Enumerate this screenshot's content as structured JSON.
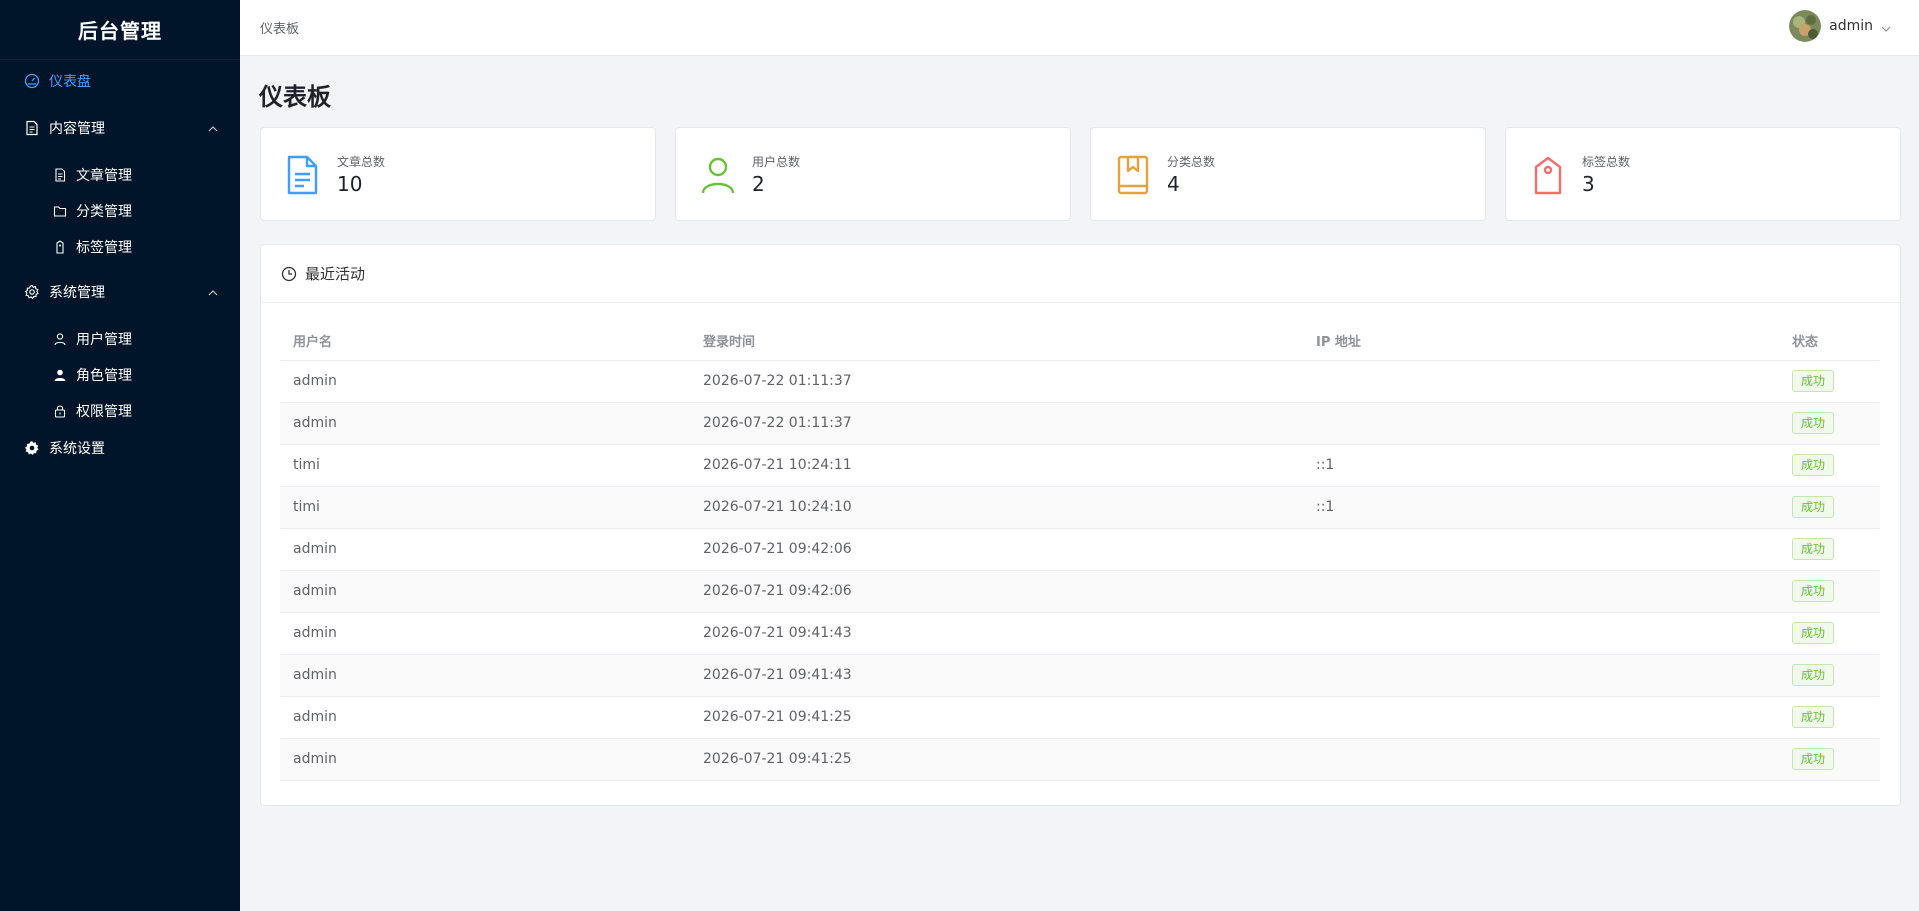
{
  "sidebar": {
    "logo": "后台管理",
    "items": [
      {
        "label": "仪表盘",
        "icon": "dashboard-icon"
      },
      {
        "label": "内容管理",
        "icon": "document-icon"
      },
      {
        "label": "文章管理",
        "icon": "file-icon"
      },
      {
        "label": "分类管理",
        "icon": "folder-icon"
      },
      {
        "label": "标签管理",
        "icon": "tag-icon"
      },
      {
        "label": "系统管理",
        "icon": "gear-icon"
      },
      {
        "label": "用户管理",
        "icon": "user-icon"
      },
      {
        "label": "角色管理",
        "icon": "user-filled-icon"
      },
      {
        "label": "权限管理",
        "icon": "lock-icon"
      },
      {
        "label": "系统设置",
        "icon": "setting-filled-icon"
      }
    ]
  },
  "header": {
    "breadcrumb": "仪表板",
    "username": "admin"
  },
  "main": {
    "title": "仪表板",
    "stats": [
      {
        "label": "文章总数",
        "value": "10",
        "icon": "document-icon",
        "color": "#409eff"
      },
      {
        "label": "用户总数",
        "value": "2",
        "icon": "user-icon",
        "color": "#67c23a"
      },
      {
        "label": "分类总数",
        "value": "4",
        "icon": "collection-icon",
        "color": "#e6a23c"
      },
      {
        "label": "标签总数",
        "value": "3",
        "icon": "price-tag-icon",
        "color": "#f56c6c"
      }
    ],
    "activity": {
      "title": "最近活动",
      "headers": [
        "用户名",
        "登录时间",
        "IP 地址",
        "状态"
      ],
      "rows": [
        {
          "user": "admin",
          "time": "2026-07-22 01:11:37",
          "ip": "",
          "status": "成功"
        },
        {
          "user": "admin",
          "time": "2026-07-22 01:11:37",
          "ip": "",
          "status": "成功"
        },
        {
          "user": "timi",
          "time": "2026-07-21 10:24:11",
          "ip": "::1",
          "status": "成功"
        },
        {
          "user": "timi",
          "time": "2026-07-21 10:24:10",
          "ip": "::1",
          "status": "成功"
        },
        {
          "user": "admin",
          "time": "2026-07-21 09:42:06",
          "ip": "",
          "status": "成功"
        },
        {
          "user": "admin",
          "time": "2026-07-21 09:42:06",
          "ip": "",
          "status": "成功"
        },
        {
          "user": "admin",
          "time": "2026-07-21 09:41:43",
          "ip": "",
          "status": "成功"
        },
        {
          "user": "admin",
          "time": "2026-07-21 09:41:43",
          "ip": "",
          "status": "成功"
        },
        {
          "user": "admin",
          "time": "2026-07-21 09:41:25",
          "ip": "",
          "status": "成功"
        },
        {
          "user": "admin",
          "time": "2026-07-21 09:41:25",
          "ip": "",
          "status": "成功"
        }
      ]
    }
  }
}
